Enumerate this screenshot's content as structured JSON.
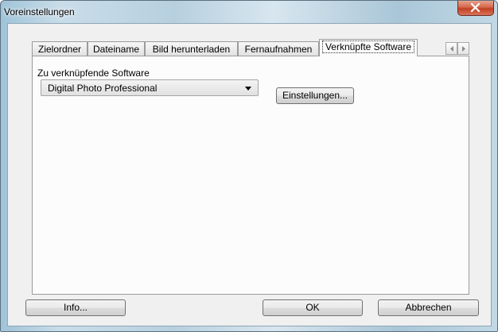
{
  "window": {
    "title": "Voreinstellungen"
  },
  "tabs": [
    {
      "label": "Zielordner",
      "active": false
    },
    {
      "label": "Dateiname",
      "active": false
    },
    {
      "label": "Bild herunterladen",
      "active": false
    },
    {
      "label": "Fernaufnahmen",
      "active": false
    },
    {
      "label": "Verknüpfte Software",
      "active": true
    }
  ],
  "linked_software": {
    "label": "Zu verknüpfende Software",
    "selected": "Digital Photo Professional",
    "settings_button": "Einstellungen..."
  },
  "footer": {
    "info_button": "Info...",
    "ok_button": "OK",
    "cancel_button": "Abbrechen"
  },
  "icons": {
    "close": "close-icon",
    "dropdown": "chevron-down-icon",
    "tab_left": "arrow-left-icon",
    "tab_right": "arrow-right-icon"
  }
}
